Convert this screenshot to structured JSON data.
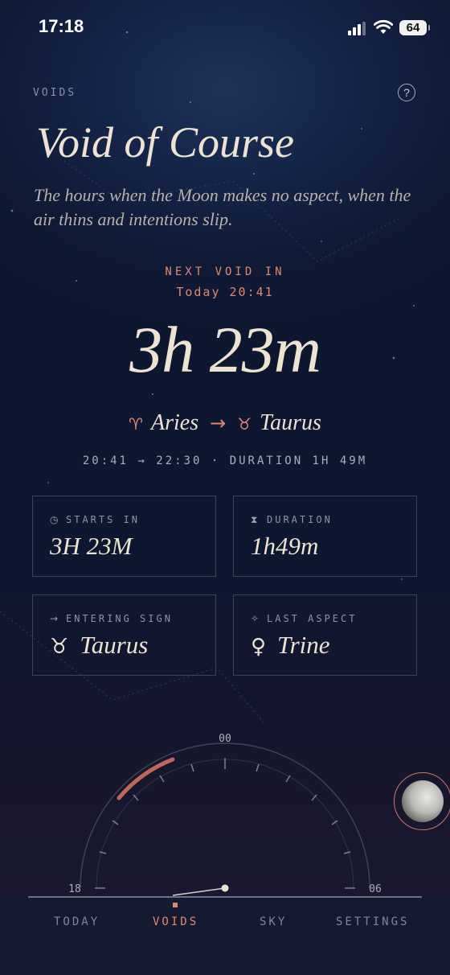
{
  "status_bar": {
    "time": "17:18",
    "battery": "64"
  },
  "header": {
    "eyebrow": "VOIDS",
    "help_icon": "?",
    "title": "Void of Course",
    "subtitle": "The hours when the Moon makes no aspect, when the air thins and intentions slip."
  },
  "next_void": {
    "label": "NEXT VOID IN",
    "when": "Today 20:41",
    "countdown": "3h 23m"
  },
  "transition": {
    "from_glyph": "♈",
    "from_sign": "Aries",
    "arrow": "→",
    "to_glyph": "♉",
    "to_sign": "Taurus"
  },
  "timeline": "20:41 → 22:30 · DURATION 1H 49M",
  "cards": [
    {
      "icon": "clock-icon",
      "icon_glyph": "◷",
      "label": "STARTS IN",
      "value": "3H 23M"
    },
    {
      "icon": "hourglass-icon",
      "icon_glyph": "⧗",
      "label": "DURATION",
      "value": "1h49m"
    },
    {
      "icon": "arrow-right-icon",
      "icon_glyph": "→",
      "label": "ENTERING SIGN",
      "value_glyph": "♉",
      "value": "Taurus"
    },
    {
      "icon": "sparkle-icon",
      "icon_glyph": "✧",
      "label": "LAST ASPECT",
      "value_glyph": "♀",
      "value": "Trine"
    }
  ],
  "dial": {
    "top_label": "00",
    "left_label": "18",
    "right_label": "06"
  },
  "nav": {
    "tabs": [
      "TODAY",
      "VOIDS",
      "SKY",
      "SETTINGS"
    ],
    "active": "VOIDS"
  },
  "colors": {
    "accent": "#e3866e",
    "text": "#ece3d0",
    "muted": "#8d94a8",
    "background": "#0f1a36"
  }
}
